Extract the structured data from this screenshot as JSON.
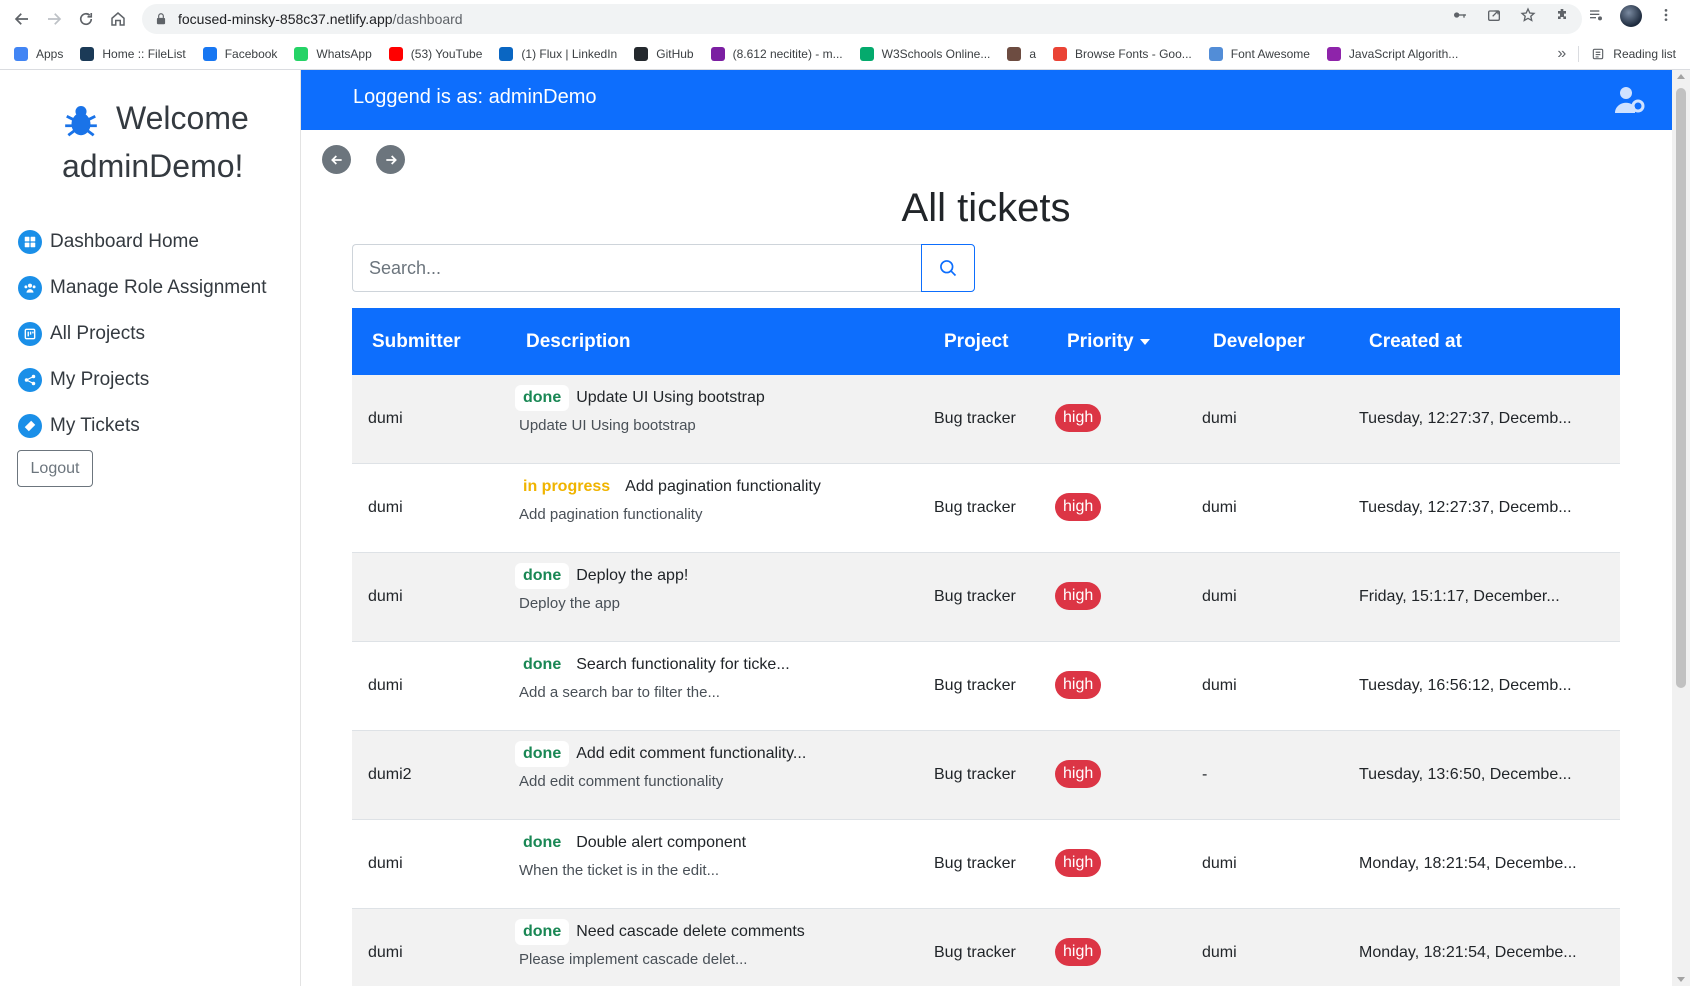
{
  "browser": {
    "url_domain": "focused-minsky-858c37.netlify.app",
    "url_path": "/dashboard",
    "bookmarks": [
      {
        "label": "Apps",
        "color": "#4285f4"
      },
      {
        "label": "Home :: FileList",
        "color": "#1b3a57"
      },
      {
        "label": "Facebook",
        "color": "#1877f2"
      },
      {
        "label": "WhatsApp",
        "color": "#25d366"
      },
      {
        "label": "(53) YouTube",
        "color": "#ff0000"
      },
      {
        "label": "(1) Flux | LinkedIn",
        "color": "#0a66c2"
      },
      {
        "label": "GitHub",
        "color": "#24292e"
      },
      {
        "label": "(8.612 necitite) - m...",
        "color": "#7b1fa2"
      },
      {
        "label": "W3Schools Online...",
        "color": "#04aa6d"
      },
      {
        "label": "a",
        "color": "#6d4c41"
      },
      {
        "label": "Browse Fonts - Goo...",
        "color": "#ea4335"
      },
      {
        "label": "Font Awesome",
        "color": "#528dd7"
      },
      {
        "label": "JavaScript Algorith...",
        "color": "#8e24aa"
      }
    ],
    "more_bookmarks": "»",
    "reading_list": "Reading list"
  },
  "sidebar": {
    "welcome_line1": "Welcome",
    "welcome_line2": "adminDemo!",
    "items": [
      {
        "label": "Dashboard Home",
        "icon": "dashboard-icon"
      },
      {
        "label": "Manage Role Assignment",
        "icon": "users-icon"
      },
      {
        "label": "All Projects",
        "icon": "projects-icon"
      },
      {
        "label": "My Projects",
        "icon": "share-icon"
      },
      {
        "label": "My Tickets",
        "icon": "ticket-icon"
      }
    ],
    "logout_label": "Logout"
  },
  "topbar": {
    "logged_text": "Loggend is as: adminDemo"
  },
  "main": {
    "title": "All tickets",
    "search_placeholder": "Search..."
  },
  "table": {
    "headers": {
      "submitter": "Submitter",
      "description": "Description",
      "project": "Project",
      "priority": "Priority",
      "developer": "Developer",
      "created": "Created at"
    },
    "rows": [
      {
        "submitter": "dumi",
        "status": "done",
        "title": "Update UI Using bootstrap",
        "desc": "Update UI Using bootstrap",
        "project": "Bug tracker",
        "priority": "high",
        "developer": "dumi",
        "created": "Tuesday, 12:27:37, Decemb..."
      },
      {
        "submitter": "dumi",
        "status": "in progress",
        "title": "Add pagination functionality",
        "desc": "Add pagination functionality",
        "project": "Bug tracker",
        "priority": "high",
        "developer": "dumi",
        "created": "Tuesday, 12:27:37, Decemb..."
      },
      {
        "submitter": "dumi",
        "status": "done",
        "title": "Deploy the app!",
        "desc": "Deploy the app",
        "project": "Bug tracker",
        "priority": "high",
        "developer": "dumi",
        "created": "Friday, 15:1:17, December..."
      },
      {
        "submitter": "dumi",
        "status": "done",
        "title": "Search functionality for ticke...",
        "desc": "Add a search bar to filter the...",
        "project": "Bug tracker",
        "priority": "high",
        "developer": "dumi",
        "created": "Tuesday, 16:56:12, Decemb..."
      },
      {
        "submitter": "dumi2",
        "status": "done",
        "title": "Add edit comment functionality...",
        "desc": "Add edit comment functionality",
        "project": "Bug tracker",
        "priority": "high",
        "developer": "-",
        "created": "Tuesday, 13:6:50, Decembe..."
      },
      {
        "submitter": "dumi",
        "status": "done",
        "title": "Double alert component",
        "desc": "When the ticket is in the edit...",
        "project": "Bug tracker",
        "priority": "high",
        "developer": "dumi",
        "created": "Monday, 18:21:54, Decembe..."
      },
      {
        "submitter": "dumi",
        "status": "done",
        "title": "Need cascade delete comments",
        "desc": "Please implement cascade delet...",
        "project": "Bug tracker",
        "priority": "high",
        "developer": "dumi",
        "created": "Monday, 18:21:54, Decembe..."
      }
    ]
  }
}
